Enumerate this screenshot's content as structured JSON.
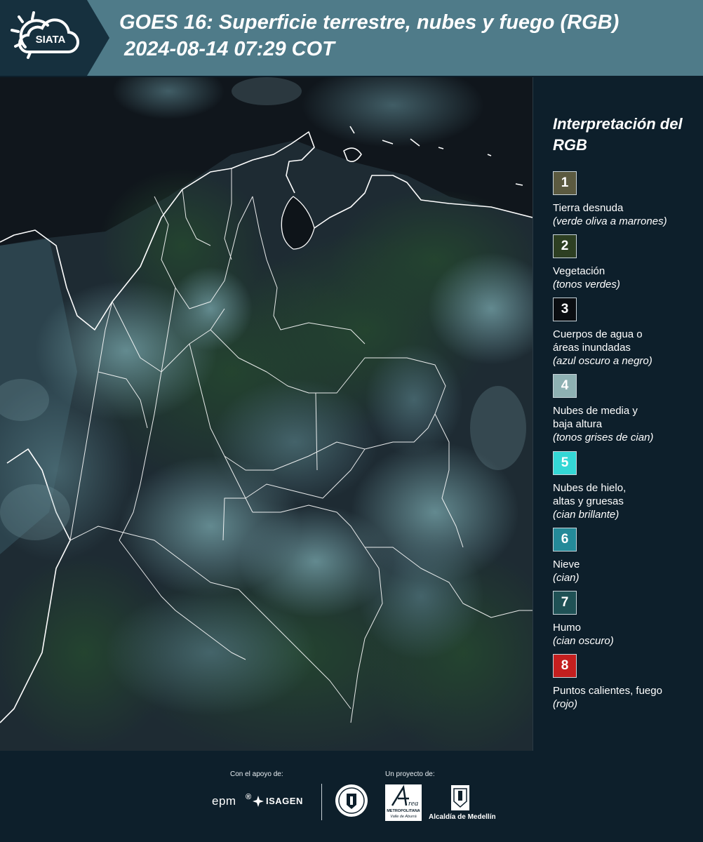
{
  "header": {
    "logo_text": "SIATA",
    "title_line1": "GOES 16: Superficie terrestre, nubes y fuego (RGB)",
    "title_line2": "2024-08-14 07:29 COT",
    "bg_color": "#4f7b89",
    "logo_bg_color": "#16303e"
  },
  "map": {
    "description_icon": "satellite-rgb-map",
    "border_color": "#ffffff"
  },
  "legend": {
    "title": "Interpretación del RGB",
    "items": [
      {
        "number": "1",
        "name": "Tierra desnuda",
        "desc": "(verde oliva a marrones)",
        "color": "#5b5a40",
        "text_color": "#ffffff"
      },
      {
        "number": "2",
        "name": "Vegetación",
        "desc": "(tonos verdes)",
        "color": "#2d3f22",
        "text_color": "#ffffff"
      },
      {
        "number": "3",
        "name": "Cuerpos de agua o\náreas inundadas",
        "desc": "(azul oscuro a negro)",
        "color": "#0a0d11",
        "text_color": "#ffffff"
      },
      {
        "number": "4",
        "name": "Nubes de media y\nbaja altura",
        "desc": "(tonos grises de cian)",
        "color": "#8eb1b3",
        "text_color": "#ffffff"
      },
      {
        "number": "5",
        "name": "Nubes de hielo,\naltas y gruesas",
        "desc": "(cian brillante)",
        "color": "#34d7d5",
        "text_color": "#ffffff"
      },
      {
        "number": "6",
        "name": "Nieve",
        "desc": "(cian)",
        "color": "#248a99",
        "text_color": "#ffffff"
      },
      {
        "number": "7",
        "name": "Humo",
        "desc": "(cian oscuro)",
        "color": "#1f5155",
        "text_color": "#ffffff"
      },
      {
        "number": "8",
        "name": "Puntos calientes, fuego",
        "desc": "(rojo)",
        "color": "#c41f1f",
        "text_color": "#ffffff"
      }
    ]
  },
  "footer": {
    "support_label": "Con el apoyo de:",
    "project_label": "Un proyecto de:",
    "sponsor1": "epm",
    "sponsor2": "ISAGEN",
    "org3_name_line1": "METROPOLITANA",
    "org3_name_line2": "Valle de Aburrá",
    "org4_name": "Alcaldía de Medellín"
  }
}
